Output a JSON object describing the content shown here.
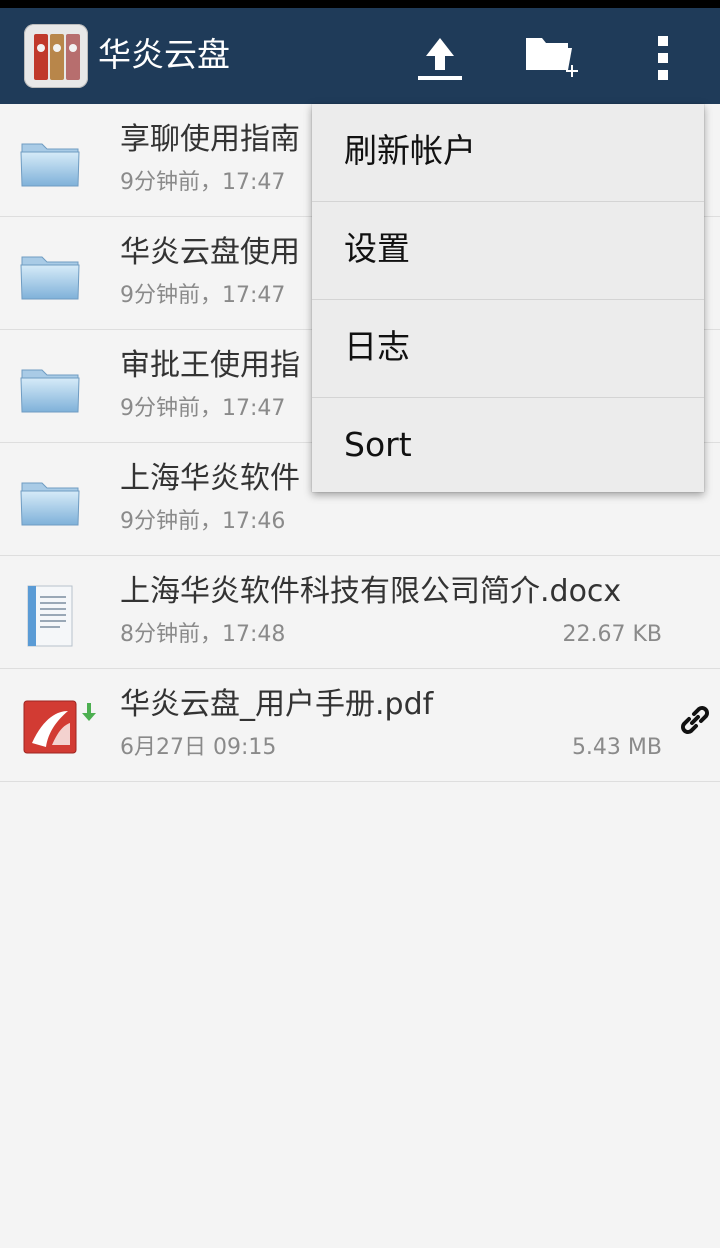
{
  "app": {
    "title": "华炎云盘",
    "accent": "#1f3b59"
  },
  "toolbar": {
    "upload_icon": "upload-icon",
    "new_folder_icon": "new-folder-icon",
    "more_icon": "overflow-menu-icon"
  },
  "files": [
    {
      "name": "享聊使用指南",
      "meta": "9分钟前，17:47",
      "size": "",
      "type": "folder"
    },
    {
      "name": "华炎云盘使用",
      "meta": "9分钟前，17:47",
      "size": "",
      "type": "folder"
    },
    {
      "name": "审批王使用指",
      "meta": "9分钟前，17:47",
      "size": "",
      "type": "folder"
    },
    {
      "name": "上海华炎软件",
      "meta": "9分钟前，17:46",
      "size": "",
      "type": "folder"
    },
    {
      "name": "上海华炎软件科技有限公司简介.docx",
      "meta": "8分钟前，17:48",
      "size": "22.67 KB",
      "type": "docx"
    },
    {
      "name": "华炎云盘_用户手册.pdf",
      "meta": "6月27日 09:15",
      "size": "5.43 MB",
      "type": "pdf"
    }
  ],
  "menu": {
    "items": [
      {
        "label": "刷新帐户"
      },
      {
        "label": "设置"
      },
      {
        "label": "日志"
      },
      {
        "label": "Sort"
      }
    ]
  }
}
